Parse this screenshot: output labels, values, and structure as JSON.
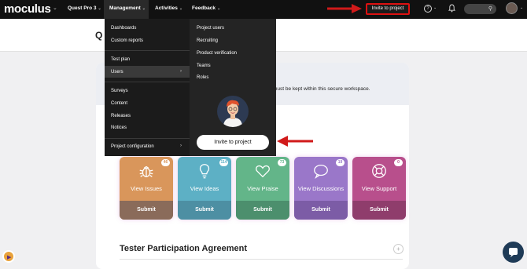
{
  "topbar": {
    "logo": "moculus",
    "nav": [
      "Quest Pro 3",
      "Management",
      "Activities",
      "Feedback"
    ],
    "invite_label": "Invite to project",
    "help_icon": "?"
  },
  "page": {
    "title": "Q",
    "notice": "must be kept within this secure workspace.",
    "agreement_title": "Tester Participation Agreement"
  },
  "dropdown": {
    "left_items": [
      "Dashboards",
      "Custom reports",
      "Test plan",
      "Users",
      "Surveys",
      "Content",
      "Releases",
      "Notices",
      "Project configuration"
    ],
    "right_items": [
      "Project users",
      "Recruiting",
      "Product verification",
      "Teams",
      "Roles"
    ],
    "invite_label": "Invite to project"
  },
  "tiles": [
    {
      "label": "View Issues",
      "badge": "46",
      "button": "Submit",
      "color": "#d9965b",
      "btn_color": "#8a6b5a"
    },
    {
      "label": "View Ideas",
      "badge": "114",
      "button": "Submit",
      "color": "#5db0c5",
      "btn_color": "#4d8fa3"
    },
    {
      "label": "View Praise",
      "badge": "73",
      "button": "Submit",
      "color": "#63b589",
      "btn_color": "#4c8f6d"
    },
    {
      "label": "View Discussions",
      "badge": "19",
      "button": "Submit",
      "color": "#9a77c9",
      "btn_color": "#7c5ca6"
    },
    {
      "label": "View Support",
      "badge": "0",
      "button": "Submit",
      "color": "#b84f8c",
      "btn_color": "#8f3d6c"
    }
  ],
  "colors": {
    "annotation": "#d11a1a",
    "topbar": "#111111"
  }
}
